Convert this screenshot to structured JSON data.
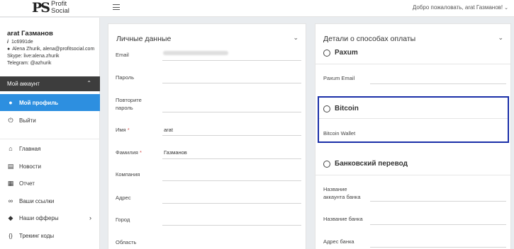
{
  "header": {
    "logo_mark": "PS",
    "logo_line1": "Profit",
    "logo_line2": "Social",
    "welcome": "Добро пожаловать, arat Газманов!"
  },
  "user": {
    "name": "arat Газманов",
    "id": "1c6991de",
    "manager": "Alena Zhurik, alena@profitsocial.com",
    "skype": "Skype: live:alena.zhurik",
    "telegram": "Telegram: @azhurik"
  },
  "sidebar": {
    "account_label": "Мой аккаунт",
    "items": [
      {
        "label": "Мой профиль",
        "icon": "user-icon",
        "active": true
      },
      {
        "label": "Выйти",
        "icon": "power-icon"
      },
      {
        "label": "Главная",
        "icon": "home-icon"
      },
      {
        "label": "Новости",
        "icon": "news-icon"
      },
      {
        "label": "Отчет",
        "icon": "report-icon"
      },
      {
        "label": "Ваши ссылки",
        "icon": "link-icon"
      },
      {
        "label": "Наши офферы",
        "icon": "layers-icon"
      },
      {
        "label": "Трекинг коды",
        "icon": "code-icon"
      }
    ]
  },
  "personal": {
    "title": "Личные данные",
    "fields": {
      "email": {
        "label": "Email",
        "value": ""
      },
      "password": {
        "label": "Пароль",
        "value": ""
      },
      "repeat": {
        "label1": "Повторите",
        "label2": "пароль",
        "value": ""
      },
      "first_name": {
        "label": "Имя",
        "value": "arat"
      },
      "last_name": {
        "label": "Фамилия",
        "value": "Газманов"
      },
      "company": {
        "label": "Компания",
        "value": ""
      },
      "address": {
        "label": "Адрес",
        "value": ""
      },
      "city": {
        "label": "Город",
        "value": ""
      },
      "region": {
        "label": "Область",
        "value": ""
      }
    },
    "required_mark": "*"
  },
  "payment": {
    "title": "Детали о способах оплаты",
    "methods": {
      "paxum": {
        "name": "Paxum",
        "field": "Paxum Email"
      },
      "bitcoin": {
        "name": "Bitcoin",
        "field": "Bitcoin Wallet"
      },
      "bank": {
        "name": "Банковский перевод",
        "field1_line1": "Название",
        "field1_line2": "аккаунта банка",
        "field2": "Название банка",
        "field3": "Адрес банка"
      }
    }
  },
  "colors": {
    "active_nav": "#2d8fe0",
    "account_bar": "#3d3d3d",
    "highlight": "#1a2fa8",
    "required": "#d9534f"
  }
}
